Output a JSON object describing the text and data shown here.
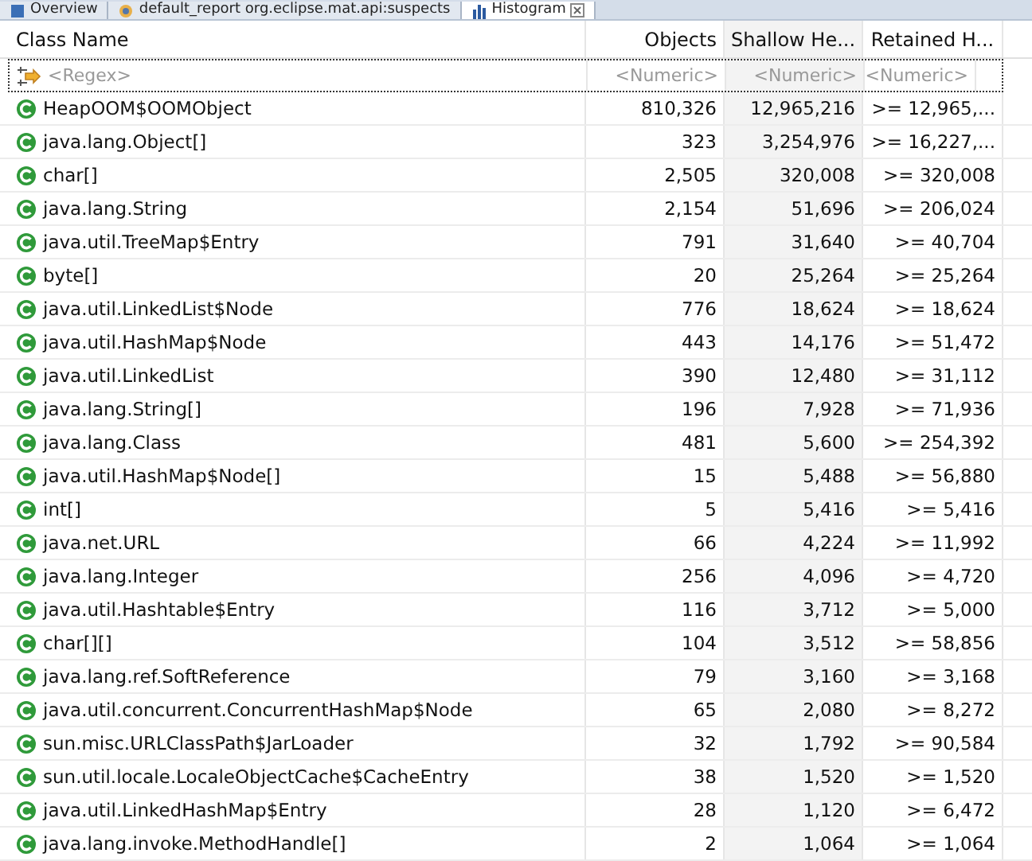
{
  "tabs": [
    {
      "label": "Overview",
      "selected": false,
      "kind": "info"
    },
    {
      "label": "default_report  org.eclipse.mat.api:suspects",
      "selected": false,
      "kind": "report"
    },
    {
      "label": "Histogram",
      "selected": true,
      "kind": "histogram"
    }
  ],
  "table": {
    "columns": [
      {
        "label": "Class Name",
        "filter": "<Regex>",
        "sorted": false
      },
      {
        "label": "Objects",
        "filter": "<Numeric>",
        "sorted": false
      },
      {
        "label": "Shallow He...",
        "filter": "<Numeric>",
        "sorted": true
      },
      {
        "label": "Retained H...",
        "filter": "<Numeric>",
        "sorted": false
      }
    ],
    "rows": [
      [
        "HeapOOM$OOMObject",
        "810,326",
        "12,965,216",
        ">= 12,965,..."
      ],
      [
        "java.lang.Object[]",
        "323",
        "3,254,976",
        ">= 16,227,..."
      ],
      [
        "char[]",
        "2,505",
        "320,008",
        ">= 320,008"
      ],
      [
        "java.lang.String",
        "2,154",
        "51,696",
        ">= 206,024"
      ],
      [
        "java.util.TreeMap$Entry",
        "791",
        "31,640",
        ">= 40,704"
      ],
      [
        "byte[]",
        "20",
        "25,264",
        ">= 25,264"
      ],
      [
        "java.util.LinkedList$Node",
        "776",
        "18,624",
        ">= 18,624"
      ],
      [
        "java.util.HashMap$Node",
        "443",
        "14,176",
        ">= 51,472"
      ],
      [
        "java.util.LinkedList",
        "390",
        "12,480",
        ">= 31,112"
      ],
      [
        "java.lang.String[]",
        "196",
        "7,928",
        ">= 71,936"
      ],
      [
        "java.lang.Class",
        "481",
        "5,600",
        ">= 254,392"
      ],
      [
        "java.util.HashMap$Node[]",
        "15",
        "5,488",
        ">= 56,880"
      ],
      [
        "int[]",
        "5",
        "5,416",
        ">= 5,416"
      ],
      [
        "java.net.URL",
        "66",
        "4,224",
        ">= 11,992"
      ],
      [
        "java.lang.Integer",
        "256",
        "4,096",
        ">= 4,720"
      ],
      [
        "java.util.Hashtable$Entry",
        "116",
        "3,712",
        ">= 5,000"
      ],
      [
        "char[][]",
        "104",
        "3,512",
        ">= 58,856"
      ],
      [
        "java.lang.ref.SoftReference",
        "79",
        "3,160",
        ">= 3,168"
      ],
      [
        "java.util.concurrent.ConcurrentHashMap$Node",
        "65",
        "2,080",
        ">= 8,272"
      ],
      [
        "sun.misc.URLClassPath$JarLoader",
        "32",
        "1,792",
        ">= 90,584"
      ],
      [
        "sun.util.locale.LocaleObjectCache$CacheEntry",
        "38",
        "1,520",
        ">= 1,520"
      ],
      [
        "java.util.LinkedHashMap$Entry",
        "28",
        "1,120",
        ">= 6,472"
      ],
      [
        "java.lang.invoke.MethodHandle[]",
        "2",
        "1,064",
        ">= 1,064"
      ]
    ]
  }
}
